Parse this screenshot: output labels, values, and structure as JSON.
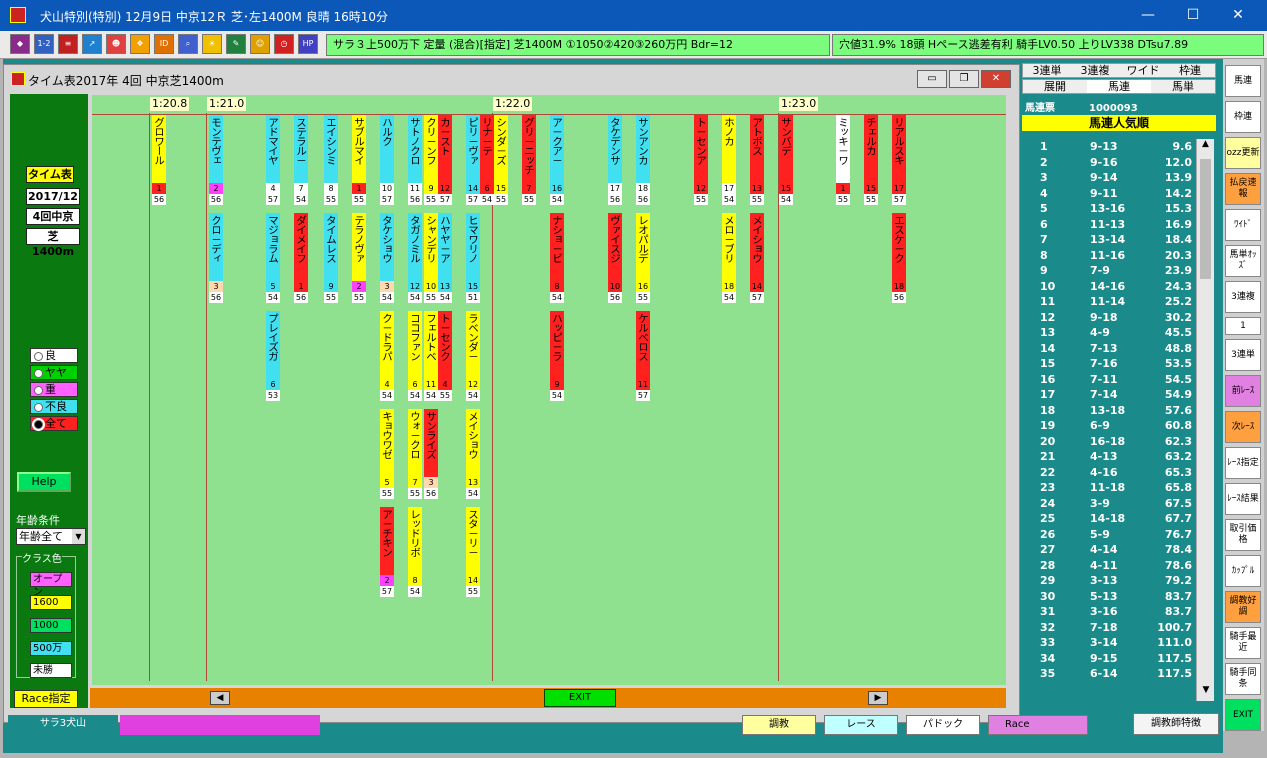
{
  "window_title": "犬山特別(特別)  12月9日  中京12Ｒ  芝･左1400M 良晴  16時10分",
  "race_info": "サラ３上500万下  定量 (混合)[指定]  芝1400M ①1050②420③260万円 Bdr=12",
  "race_stats": "穴値31.9% 18頭  Hペース逃差有利 騎手LV0.50 上りLV338 DTsu7.89",
  "inner_title": "タイム表2017年 4回 中京芝1400m",
  "left_panel": {
    "heading": "タイム表",
    "date": "2017/12",
    "meeting": "4回中京",
    "course": "芝1400m",
    "conditions": [
      "良",
      "ヤヤ",
      "重",
      "不良",
      "全て"
    ],
    "selected_condition": "全て",
    "help": "Help",
    "age_label": "年齢条件",
    "age_select": "年齢全て",
    "class_label": "クラス色",
    "classes": [
      "オープン",
      "1600",
      "1000",
      "500万",
      "未勝"
    ],
    "race_btn": "Race指定"
  },
  "time_labels": [
    "1:20.8",
    "1:21.0",
    "1:22.0",
    "1:23.0"
  ],
  "horses": [
    {
      "name": "グロワール",
      "no": "1",
      "wt": "56"
    },
    {
      "name": "モンテヴェ",
      "no": "2",
      "wt": "56"
    },
    {
      "name": "クロ－ディ",
      "no": "3",
      "wt": "56"
    },
    {
      "name": "アドマイヤ",
      "no": "4",
      "wt": "57"
    },
    {
      "name": "マジョラム",
      "no": "5",
      "wt": "54"
    },
    {
      "name": "プレイズガ",
      "no": "6",
      "wt": "53"
    },
    {
      "name": "ステラル－",
      "no": "7",
      "wt": "54"
    },
    {
      "name": "ダイメイフ",
      "no": "1",
      "wt": "56"
    },
    {
      "name": "エイシンミ",
      "no": "8",
      "wt": "55"
    },
    {
      "name": "タイムレス",
      "no": "9",
      "wt": "55"
    },
    {
      "name": "サブルマイ",
      "no": "1",
      "wt": "55"
    },
    {
      "name": "テラノヴァ",
      "no": "2",
      "wt": "55"
    },
    {
      "name": "ハルク",
      "no": "10",
      "wt": "57"
    },
    {
      "name": "タケショウ",
      "no": "3",
      "wt": "54"
    },
    {
      "name": "ク－ドラパ",
      "no": "4",
      "wt": "54"
    },
    {
      "name": "キョウワゼ",
      "no": "5",
      "wt": "55"
    },
    {
      "name": "ア－チキン",
      "no": "2",
      "wt": "57"
    },
    {
      "name": "サトノクロ",
      "no": "11",
      "wt": "56"
    },
    {
      "name": "タガノミル",
      "no": "12",
      "wt": "54"
    },
    {
      "name": "ココファン",
      "no": "6",
      "wt": "54"
    },
    {
      "name": "ウォ－クロ",
      "no": "7",
      "wt": "55"
    },
    {
      "name": "レッドリボ",
      "no": "8",
      "wt": "54"
    },
    {
      "name": "クリ－ンフ",
      "no": "9",
      "wt": "55"
    },
    {
      "name": "シャンデリ",
      "no": "10",
      "wt": "55"
    },
    {
      "name": "フェルトベ",
      "no": "11",
      "wt": "54"
    },
    {
      "name": "サンライズ",
      "no": "3",
      "wt": "56"
    },
    {
      "name": "カ－スト",
      "no": "12",
      "wt": "57"
    },
    {
      "name": "ハヤヤ－ア",
      "no": "13",
      "wt": "54"
    },
    {
      "name": "ト－センク",
      "no": "4",
      "wt": "55"
    },
    {
      "name": "ピリ－ヴァ",
      "no": "14",
      "wt": "57"
    },
    {
      "name": "ヒマワリノ",
      "no": "15",
      "wt": "51"
    },
    {
      "name": "ラベンダ－",
      "no": "12",
      "wt": "54"
    },
    {
      "name": "メイショウ",
      "no": "13",
      "wt": "54"
    },
    {
      "name": "スタ－リ－",
      "no": "14",
      "wt": "55"
    },
    {
      "name": "リナ－テ",
      "no": "6",
      "wt": "54"
    },
    {
      "name": "シンダ－ズ",
      "no": "15",
      "wt": "55"
    },
    {
      "name": "グリ－ニッチ",
      "no": "7",
      "wt": "55"
    },
    {
      "name": "ア－クア－",
      "no": "16",
      "wt": "54"
    },
    {
      "name": "ナショ－ビ",
      "no": "8",
      "wt": "54"
    },
    {
      "name": "ハッピ－ラ",
      "no": "9",
      "wt": "54"
    },
    {
      "name": "タケデンサ",
      "no": "17",
      "wt": "56"
    },
    {
      "name": "ヴァイスジ",
      "no": "10",
      "wt": "56"
    },
    {
      "name": "サンアンカ",
      "no": "18",
      "wt": "56"
    },
    {
      "name": "レオパルデ",
      "no": "16",
      "wt": "55"
    },
    {
      "name": "ケルベロス",
      "no": "11",
      "wt": "57"
    },
    {
      "name": "ト－センア",
      "no": "12",
      "wt": "55"
    },
    {
      "name": "ホノカ",
      "no": "17",
      "wt": "54"
    },
    {
      "name": "メロ－ブリ",
      "no": "18",
      "wt": "54"
    },
    {
      "name": "アトボス",
      "no": "13",
      "wt": "55"
    },
    {
      "name": "メイショウ",
      "no": "14",
      "wt": "57"
    },
    {
      "name": "サンバデ",
      "no": "15",
      "wt": "54"
    },
    {
      "name": "ミッキ－ワ",
      "no": "1",
      "wt": "55"
    },
    {
      "name": "チェルカ",
      "no": "15",
      "wt": "55"
    },
    {
      "name": "リアルスキ",
      "no": "17",
      "wt": "57"
    },
    {
      "name": "エスケ－ク",
      "no": "18",
      "wt": "56"
    }
  ],
  "colors": {
    "yellow": "#ffff00",
    "red": "#ff2020",
    "cyan": "#40e0f0",
    "magenta": "#ff40ff",
    "peach": "#ffd8b0",
    "white": "#ffffff"
  },
  "bottom": {
    "exit": "EXIT",
    "left": "◀",
    "right": "▶"
  },
  "tabs_row1": [
    "3連単",
    "3連複",
    "ワイド",
    "枠連"
  ],
  "tabs_row2": [
    "展開",
    "馬連",
    "馬単"
  ],
  "odds_header": "馬連票",
  "odds_count": "1000093",
  "odds_title": "馬連人気順",
  "odds": [
    {
      "r": "1",
      "c": "9-13",
      "v": "9.6"
    },
    {
      "r": "2",
      "c": "9-16",
      "v": "12.0"
    },
    {
      "r": "3",
      "c": "9-14",
      "v": "13.9"
    },
    {
      "r": "4",
      "c": "9-11",
      "v": "14.2"
    },
    {
      "r": "5",
      "c": "13-16",
      "v": "15.3"
    },
    {
      "r": "6",
      "c": "11-13",
      "v": "16.9"
    },
    {
      "r": "7",
      "c": "13-14",
      "v": "18.4"
    },
    {
      "r": "8",
      "c": "11-16",
      "v": "20.3"
    },
    {
      "r": "9",
      "c": "7-9",
      "v": "23.9"
    },
    {
      "r": "10",
      "c": "14-16",
      "v": "24.3"
    },
    {
      "r": "11",
      "c": "11-14",
      "v": "25.2"
    },
    {
      "r": "12",
      "c": "9-18",
      "v": "30.2"
    },
    {
      "r": "13",
      "c": "4-9",
      "v": "45.5"
    },
    {
      "r": "14",
      "c": "7-13",
      "v": "48.8"
    },
    {
      "r": "15",
      "c": "7-16",
      "v": "53.5"
    },
    {
      "r": "16",
      "c": "7-11",
      "v": "54.5"
    },
    {
      "r": "17",
      "c": "7-14",
      "v": "54.9"
    },
    {
      "r": "18",
      "c": "13-18",
      "v": "57.6"
    },
    {
      "r": "19",
      "c": "6-9",
      "v": "60.8"
    },
    {
      "r": "20",
      "c": "16-18",
      "v": "62.3"
    },
    {
      "r": "21",
      "c": "4-13",
      "v": "63.2"
    },
    {
      "r": "22",
      "c": "4-16",
      "v": "65.3"
    },
    {
      "r": "23",
      "c": "11-18",
      "v": "65.8"
    },
    {
      "r": "24",
      "c": "3-9",
      "v": "67.5"
    },
    {
      "r": "25",
      "c": "14-18",
      "v": "67.7"
    },
    {
      "r": "26",
      "c": "5-9",
      "v": "76.7"
    },
    {
      "r": "27",
      "c": "4-14",
      "v": "78.4"
    },
    {
      "r": "28",
      "c": "4-11",
      "v": "78.6"
    },
    {
      "r": "29",
      "c": "3-13",
      "v": "79.2"
    },
    {
      "r": "30",
      "c": "5-13",
      "v": "83.7"
    },
    {
      "r": "31",
      "c": "3-16",
      "v": "83.7"
    },
    {
      "r": "32",
      "c": "7-18",
      "v": "100.7"
    },
    {
      "r": "33",
      "c": "3-14",
      "v": "111.0"
    },
    {
      "r": "34",
      "c": "9-15",
      "v": "117.5"
    },
    {
      "r": "35",
      "c": "6-14",
      "v": "117.5"
    }
  ],
  "side_buttons": [
    "馬連",
    "枠連",
    "ozz更新",
    "払戻速報",
    "ﾜｲﾄﾞ",
    "馬単ｵｯｽﾞ",
    "3連複",
    "1",
    "3連単",
    "前ﾚｰｽ",
    "次ﾚｰｽ",
    "ﾚｰｽ指定",
    "ﾚｰｽ結果",
    "取引価格",
    "ｶｯﾌﾟﾙ",
    "調教好調",
    "騎手最近",
    "騎手同条",
    "EXIT"
  ],
  "footer": {
    "left_label": "サラ3犬山",
    "b1": "調教",
    "b2": "レース",
    "b3": "パドック",
    "b4": "Race",
    "b5": "調教師特徴"
  }
}
